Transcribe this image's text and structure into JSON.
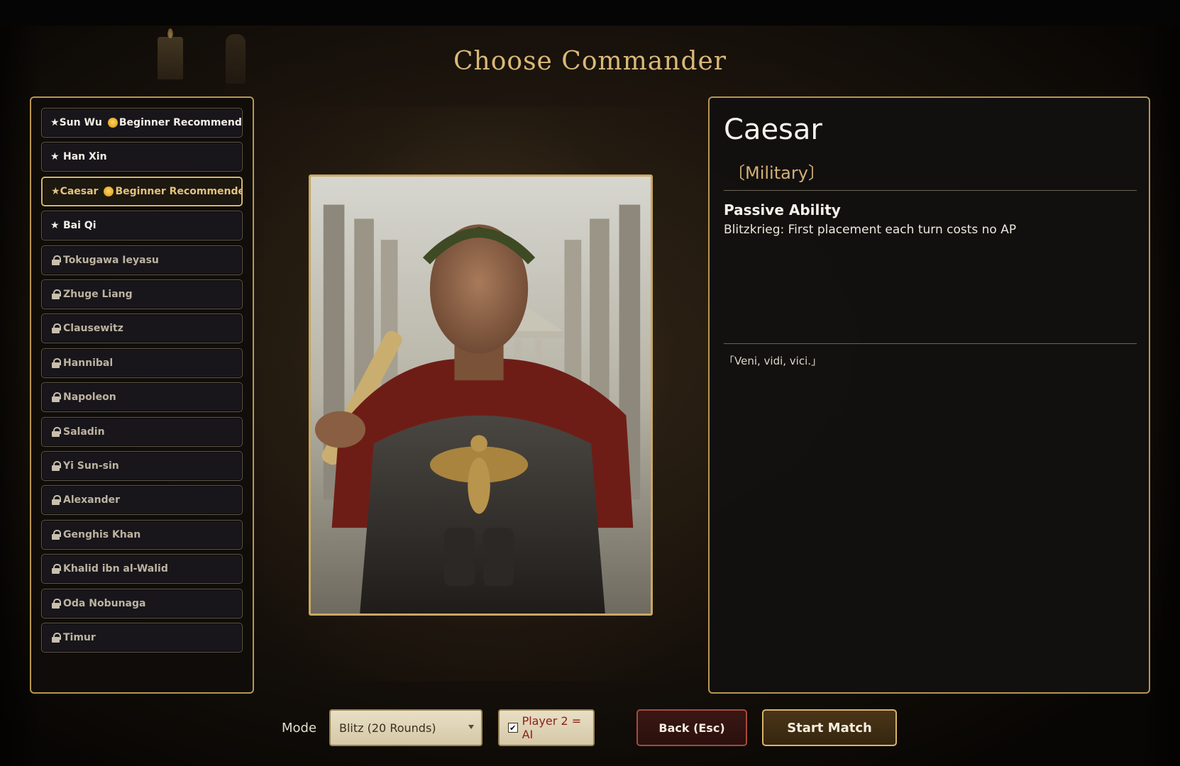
{
  "screen": {
    "title": "Choose Commander"
  },
  "commanders": [
    {
      "name": "Sun Wu",
      "status": "unlocked",
      "badge": "Beginner Recommended"
    },
    {
      "name": "Han Xin",
      "status": "unlocked",
      "badge": ""
    },
    {
      "name": "Caesar",
      "status": "selected",
      "badge": "Beginner Recommended"
    },
    {
      "name": "Bai Qi",
      "status": "unlocked",
      "badge": ""
    },
    {
      "name": "Tokugawa Ieyasu",
      "status": "locked",
      "badge": ""
    },
    {
      "name": "Zhuge Liang",
      "status": "locked",
      "badge": ""
    },
    {
      "name": "Clausewitz",
      "status": "locked",
      "badge": ""
    },
    {
      "name": "Hannibal",
      "status": "locked",
      "badge": ""
    },
    {
      "name": "Napoleon",
      "status": "locked",
      "badge": ""
    },
    {
      "name": "Saladin",
      "status": "locked",
      "badge": ""
    },
    {
      "name": "Yi Sun-sin",
      "status": "locked",
      "badge": ""
    },
    {
      "name": "Alexander",
      "status": "locked",
      "badge": ""
    },
    {
      "name": "Genghis Khan",
      "status": "locked",
      "badge": ""
    },
    {
      "name": "Khalid ibn al-Walid",
      "status": "locked",
      "badge": ""
    },
    {
      "name": "Oda Nobunaga",
      "status": "locked",
      "badge": ""
    },
    {
      "name": "Timur",
      "status": "locked",
      "badge": ""
    }
  ],
  "icons": {
    "unlocked": "star-icon",
    "locked": "lock-icon",
    "badge": "beginner-badge-icon"
  },
  "detail": {
    "name": "Caesar",
    "category": "〔Military〕",
    "ability_heading": "Passive Ability",
    "ability_text": "Blitzkrieg: First placement each turn costs no AP",
    "quote": "「Veni, vidi, vici.」"
  },
  "controls": {
    "mode_label": "Mode",
    "mode_value": "Blitz (20 Rounds)",
    "ai_label": "Player 2 = AI",
    "ai_checked": true,
    "back_label": "Back (Esc)",
    "start_label": "Start Match"
  },
  "colors": {
    "accent_gold": "#c9a862",
    "title_gold": "#d9b978",
    "back_red": "#a84a3a",
    "ai_red": "#8b1f16"
  }
}
